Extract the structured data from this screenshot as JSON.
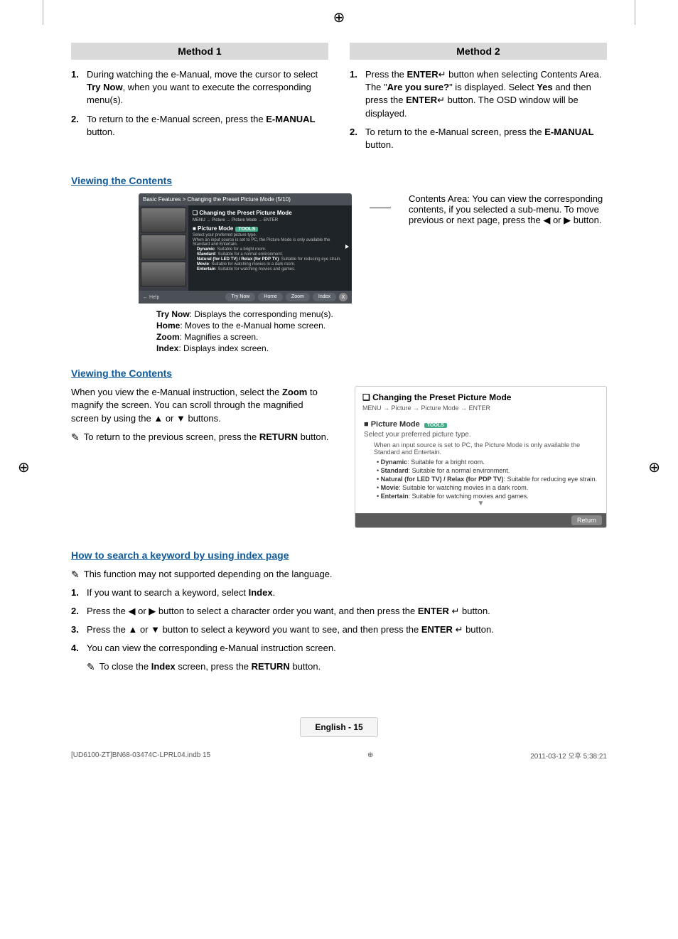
{
  "reg_marks": {
    "top": "⊕",
    "left": "⊕",
    "right": "⊕",
    "footer": "⊕"
  },
  "method1": {
    "header": "Method 1",
    "steps": [
      {
        "num": "1.",
        "text_a": "During watching the e-Manual, move the cursor to select ",
        "bold_a": "Try Now",
        "text_b": ", when you want to execute the corresponding menu(s)."
      },
      {
        "num": "2.",
        "text_a": "To return to the e-Manual screen, press the ",
        "bold_a": "E-MANUAL",
        "text_b": " button."
      }
    ]
  },
  "method2": {
    "header": "Method 2",
    "steps": [
      {
        "num": "1.",
        "text_a": "Press the ",
        "bold_a": "ENTER",
        "icon_a": "↵",
        "text_b": " button when selecting Contents Area. The \"",
        "bold_b": "Are you sure?",
        "text_c": "\" is displayed. Select ",
        "bold_c": "Yes",
        "text_d": " and then press the ",
        "bold_d": "ENTER",
        "icon_b": "↵",
        "text_e": " button. The OSD window will be displayed."
      },
      {
        "num": "2.",
        "text_a": "To return to the e-Manual screen, press the ",
        "bold_a": "E-MANUAL",
        "text_b": " button."
      }
    ]
  },
  "viewing": {
    "title": "Viewing the Contents",
    "callout": "Contents Area: You can view the corresponding contents, if you selected a sub-menu. To move previous or next page, press the ◀ or ▶ button."
  },
  "screen": {
    "breadcrumb": "Basic Features > Changing the Preset Picture Mode (5/10)",
    "section_title": "❏ Changing the Preset Picture Mode",
    "section_path": "MENU → Picture → Picture Mode → ENTER",
    "mode_head": "■ Picture Mode",
    "tools": "TOOLS",
    "select_text": "Select your preferred picture type.",
    "note": "When an input source is set to PC, the Picture Mode is only available the Standard and Entertain.",
    "bullets": [
      {
        "name": "Dynamic",
        "desc": ": Suitable for a bright room."
      },
      {
        "name": "Standard",
        "desc": ": Suitable for a normal environment."
      },
      {
        "name_combo": "Natural (for LED TV) / Relax (for PDP TV)",
        "desc": ": Suitable for reducing eye strain."
      },
      {
        "name": "Movie",
        "desc": ": Suitable for watching movies in a dark room."
      },
      {
        "name": "Entertain",
        "desc": ": Suitable for watching movies and games."
      }
    ],
    "help": "← Help",
    "buttons": {
      "trynow": "Try Now",
      "home": "Home",
      "zoom": "Zoom",
      "index": "Index",
      "close": "X"
    }
  },
  "captions": [
    {
      "label": "Try Now",
      "desc": ": Displays the corresponding menu(s)."
    },
    {
      "label": "Home",
      "desc": ": Moves to the e-Manual home screen."
    },
    {
      "label": "Zoom",
      "desc": ": Magnifies a screen."
    },
    {
      "label": "Index",
      "desc": ": Displays index screen."
    }
  ],
  "viewing2": {
    "title": "Viewing the Contents",
    "para": "When you view the e-Manual instruction, select the Zoom to magnify the screen. You can scroll through the magnified screen by using the ▲ or ▼ buttons.",
    "note": "To return to the previous screen, press the RETURN button."
  },
  "zoom_panel": {
    "title": "❏ Changing the Preset Picture Mode",
    "path": "MENU → Picture → Picture Mode → ENTER",
    "mode_head": "■ Picture Mode",
    "tools": "TOOLS",
    "select": "Select your preferred picture type.",
    "note": "When an input source is set to PC, the Picture Mode is only available the Standard and Entertain.",
    "bullets": [
      {
        "name": "Dynamic",
        "desc": ": Suitable for a bright room."
      },
      {
        "name": "Standard",
        "desc": ": Suitable for a normal environment."
      },
      {
        "name": "Natural (for LED TV) / Relax (for PDP TV)",
        "desc": ": Suitable for reducing eye strain."
      },
      {
        "name": "Movie",
        "desc": ": Suitable for watching movies in a dark room."
      },
      {
        "name": "Entertain",
        "desc": ": Suitable for watching movies and games."
      }
    ],
    "return": "Return"
  },
  "index_section": {
    "title": "How to search a keyword by using index page",
    "note_top": "This function may not supported depending on the language.",
    "steps": [
      {
        "num": "1.",
        "text": "If you want to search a keyword, select Index."
      },
      {
        "num": "2.",
        "text": "Press the ◀ or ▶ button to select a character order you want, and then press the ENTER ↵ button."
      },
      {
        "num": "3.",
        "text": "Press the ▲ or ▼ button to select a keyword you want to see, and then press the ENTER ↵ button."
      },
      {
        "num": "4.",
        "text": "You can view the corresponding e-Manual instruction screen."
      }
    ],
    "note_bottom": "To close the Index screen, press the RETURN button."
  },
  "footer": {
    "lang": "English - 15"
  },
  "print": {
    "left": "[UD6100-ZT]BN68-03474C-LPRL04.indb   15",
    "right": "2011-03-12   오후 5:38:21"
  }
}
